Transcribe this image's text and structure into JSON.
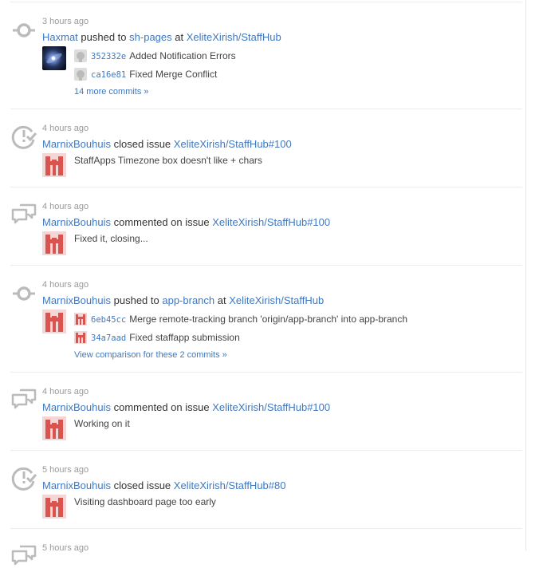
{
  "events": [
    {
      "type": "push",
      "time": "3 hours ago",
      "user": "Haxmat",
      "action": "pushed to",
      "branch": "sh-pages",
      "at": "at",
      "repo": "XeliteXirish/StaffHub",
      "commits": [
        {
          "sha": "352332e",
          "message": "Added Notification Errors"
        },
        {
          "sha": "ca16e81",
          "message": "Fixed Merge Conflict"
        }
      ],
      "more": "14 more commits »"
    },
    {
      "type": "issue-closed",
      "time": "4 hours ago",
      "user": "MarnixBouhuis",
      "action": "closed issue",
      "target": "XeliteXirish/StaffHub#100",
      "body": "StaffApps Timezone box doesn't like + chars"
    },
    {
      "type": "comment",
      "time": "4 hours ago",
      "user": "MarnixBouhuis",
      "action": "commented on issue",
      "target": "XeliteXirish/StaffHub#100",
      "body": "Fixed it, closing..."
    },
    {
      "type": "push",
      "time": "4 hours ago",
      "user": "MarnixBouhuis",
      "action": "pushed to",
      "branch": "app-branch",
      "at": "at",
      "repo": "XeliteXirish/StaffHub",
      "commits": [
        {
          "sha": "6eb45cc",
          "message": "Merge remote-tracking branch 'origin/app-branch' into app-branch"
        },
        {
          "sha": "34a7aad",
          "message": "Fixed staffapp submission"
        }
      ],
      "more": "View comparison for these 2 commits »"
    },
    {
      "type": "comment",
      "time": "4 hours ago",
      "user": "MarnixBouhuis",
      "action": "commented on issue",
      "target": "XeliteXirish/StaffHub#100",
      "body": "Working on it"
    },
    {
      "type": "issue-closed",
      "time": "5 hours ago",
      "user": "MarnixBouhuis",
      "action": "closed issue",
      "target": "XeliteXirish/StaffHub#80",
      "body": "Visiting dashboard page too early"
    },
    {
      "type": "comment",
      "time": "5 hours ago"
    }
  ],
  "colors": {
    "link": "#4078c0",
    "muted": "#999999",
    "icon": "#bbbbbb",
    "identicon": "#d9534f"
  }
}
